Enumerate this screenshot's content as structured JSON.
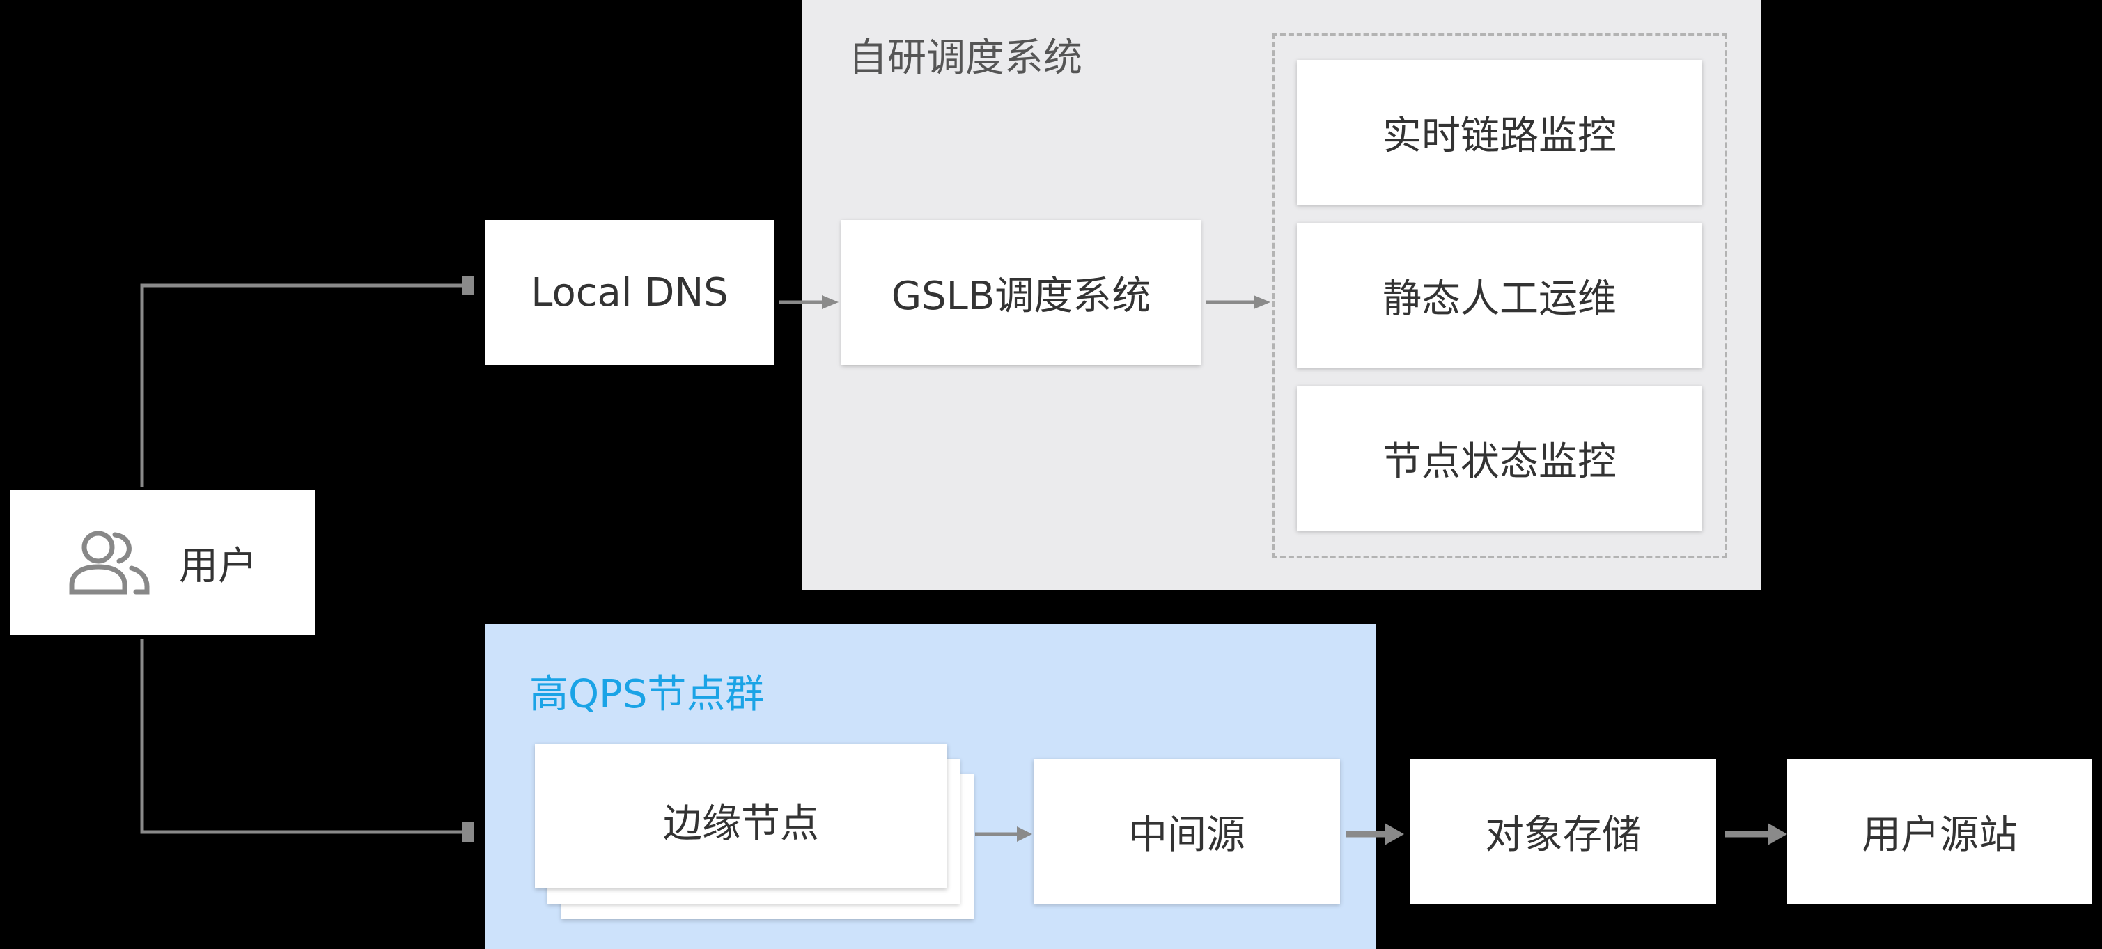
{
  "self_system": {
    "title": "自研调度系统"
  },
  "qps_group": {
    "title": "高QPS节点群"
  },
  "nodes": {
    "user": "用户",
    "local_dns": "Local DNS",
    "gslb": "GSLB调度系统",
    "realtime_monitor": "实时链路监控",
    "static_ops": "静态人工运维",
    "node_monitor": "节点状态监控",
    "edge_nodes": "边缘节点",
    "middle_origin": "中间源",
    "object_storage": "对象存储",
    "user_origin": "用户源站"
  },
  "colors": {
    "line": "#8a8a8a",
    "qps_title": "#1aa3e6",
    "panel_gray": "#ebebed",
    "panel_blue": "#cde2fb"
  },
  "icons": {
    "user": "users-icon"
  }
}
